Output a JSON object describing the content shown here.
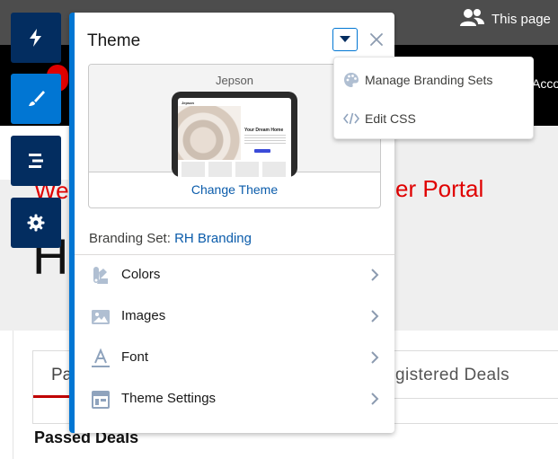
{
  "background": {
    "header_text": "This page",
    "account_text": "Accou",
    "hero_left": "We",
    "hero_right": "er Portal",
    "big_letter": "H",
    "tab_left_partial": "Pa",
    "tab_right_partial": "gistered Deals",
    "section_heading": "Passed Deals"
  },
  "toolbar": {
    "items": [
      {
        "icon": "lightning-icon"
      },
      {
        "icon": "paintbrush-icon",
        "active": true
      },
      {
        "icon": "page-structure-icon"
      },
      {
        "icon": "gear-icon"
      }
    ]
  },
  "panel": {
    "title": "Theme",
    "theme_card": {
      "theme_name": "Jepson",
      "preview_nav": "Jepson",
      "preview_title": "Your Dream Home",
      "change_label": "Change Theme"
    },
    "branding_label": "Branding Set:",
    "branding_value": "RH Branding",
    "menu": [
      {
        "label": "Colors",
        "icon": "color-swatch-icon"
      },
      {
        "label": "Images",
        "icon": "image-icon"
      },
      {
        "label": "Font",
        "icon": "font-icon"
      },
      {
        "label": "Theme Settings",
        "icon": "layout-icon"
      }
    ]
  },
  "dropdown_menu": {
    "items": [
      {
        "label": "Manage Branding Sets",
        "icon": "palette-icon"
      },
      {
        "label": "Edit CSS",
        "icon": "code-icon"
      }
    ]
  },
  "colors": {
    "accent": "#0176d3",
    "toolbar_dark": "#032d60",
    "link": "#0b5cab",
    "hero_red": "#e00000"
  }
}
